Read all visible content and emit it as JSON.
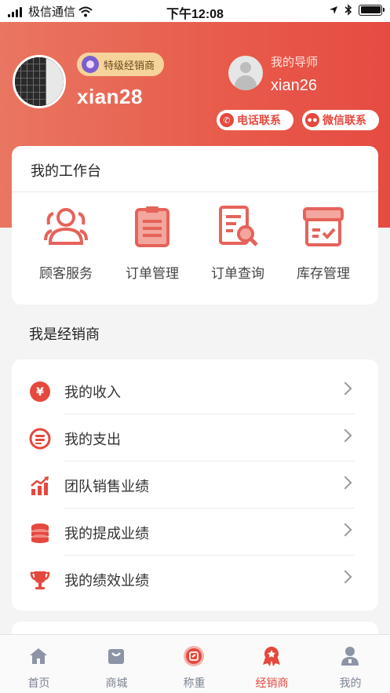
{
  "status_bar": {
    "carrier": "极信通信",
    "time": "下午12:08"
  },
  "profile": {
    "badge": "特级经销商",
    "username": "xian28"
  },
  "mentor": {
    "label": "我的导师",
    "name": "xian26",
    "phone_button": "电话联系",
    "wechat_button": "微信联系"
  },
  "workbench": {
    "title": "我的工作台",
    "tools": [
      {
        "label": "顾客服务",
        "icon": "customers-icon"
      },
      {
        "label": "订单管理",
        "icon": "clipboard-icon"
      },
      {
        "label": "订单查询",
        "icon": "document-search-icon"
      },
      {
        "label": "库存管理",
        "icon": "inventory-box-icon"
      }
    ]
  },
  "dealer": {
    "section_title": "我是经销商",
    "items": [
      {
        "label": "我的收入",
        "icon": "yen-icon"
      },
      {
        "label": "我的支出",
        "icon": "coins-out-icon"
      },
      {
        "label": "团队销售业绩",
        "icon": "growth-chart-icon"
      },
      {
        "label": "我的提成业绩",
        "icon": "coin-stack-icon"
      },
      {
        "label": "我的绩效业绩",
        "icon": "trophy-icon"
      }
    ]
  },
  "tabbar": {
    "tabs": [
      {
        "label": "首页",
        "icon": "home-icon"
      },
      {
        "label": "商城",
        "icon": "shop-bag-icon"
      },
      {
        "label": "称重",
        "icon": "scale-icon"
      },
      {
        "label": "经销商",
        "icon": "dealer-medal-icon",
        "active": true
      },
      {
        "label": "我的",
        "icon": "user-icon"
      }
    ]
  },
  "colors": {
    "accent": "#e5483d",
    "header_gradient_start": "#e97661",
    "header_gradient_end": "#e64b42",
    "badge_bg": "#f6d39a",
    "tab_inactive": "#7d8494"
  }
}
